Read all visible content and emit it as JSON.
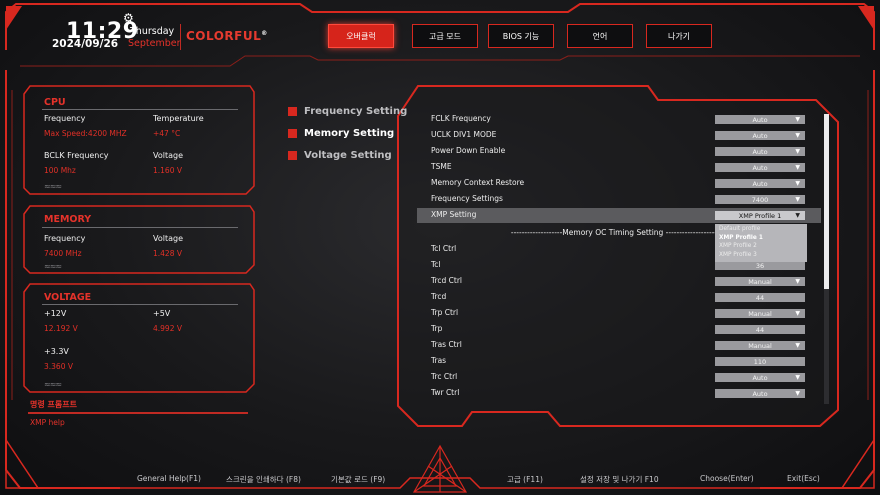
{
  "header": {
    "time": "11:29",
    "date": "2024/09/26",
    "weekday": "Thursday",
    "month": "September",
    "brand": "COLORFUL",
    "brand_mark": "®"
  },
  "tabs": [
    {
      "label": "오버클럭",
      "active": true
    },
    {
      "label": "고급 모드",
      "active": false
    },
    {
      "label": "BIOS 기능",
      "active": false
    },
    {
      "label": "언어",
      "active": false
    },
    {
      "label": "나가기",
      "active": false
    }
  ],
  "cpu": {
    "title": "CPU",
    "frequency_label": "Frequency",
    "frequency_value": "Max Speed:4200 MHZ",
    "temperature_label": "Temperature",
    "temperature_value": "+47 °C",
    "bclk_label": "BCLK Frequency",
    "bclk_value": "100 Mhz",
    "voltage_label": "Voltage",
    "voltage_value": "1.160 V"
  },
  "memory": {
    "title": "MEMORY",
    "frequency_label": "Frequency",
    "frequency_value": "7400 MHz",
    "voltage_label": "Voltage",
    "voltage_value": "1.428 V"
  },
  "voltage": {
    "title": "VOLTAGE",
    "v12_label": "+12V",
    "v12_value": "12.192 V",
    "v5_label": "+5V",
    "v5_value": "4.992 V",
    "v33_label": "+3.3V",
    "v33_value": "3.360 V"
  },
  "help": {
    "title": "명령 프롬프트",
    "text": "XMP help"
  },
  "submenu": [
    {
      "label": "Frequency Setting",
      "active": false
    },
    {
      "label": "Memory Setting",
      "active": true
    },
    {
      "label": "Voltage Setting",
      "active": false
    }
  ],
  "settings": [
    {
      "label": "FCLK Frequency",
      "value": "Auto",
      "dropdown": true
    },
    {
      "label": "UCLK DIV1 MODE",
      "value": "Auto",
      "dropdown": true
    },
    {
      "label": "Power Down Enable",
      "value": "Auto",
      "dropdown": true
    },
    {
      "label": "TSME",
      "value": "Auto",
      "dropdown": true
    },
    {
      "label": "Memory Context Restore",
      "value": "Auto",
      "dropdown": true
    },
    {
      "label": "Frequency Settings",
      "value": "7400",
      "dropdown": true
    },
    {
      "label": "XMP Setting",
      "value": "XMP Profile 1",
      "dropdown": true,
      "selected": true
    }
  ],
  "section_header": "-------------------Memory OC Timing Setting -------------------",
  "timings": [
    {
      "label": "Tcl Ctrl",
      "value": "",
      "dropdown": false,
      "hidden_by_popup": true
    },
    {
      "label": "Tcl",
      "value": "36",
      "dropdown": false
    },
    {
      "label": "Trcd Ctrl",
      "value": "Manual",
      "dropdown": true
    },
    {
      "label": "Trcd",
      "value": "44",
      "dropdown": false
    },
    {
      "label": "Trp Ctrl",
      "value": "Manual",
      "dropdown": true
    },
    {
      "label": "Trp",
      "value": "44",
      "dropdown": false
    },
    {
      "label": "Tras Ctrl",
      "value": "Manual",
      "dropdown": true
    },
    {
      "label": "Tras",
      "value": "110",
      "dropdown": false
    },
    {
      "label": "Trc Ctrl",
      "value": "Auto",
      "dropdown": true
    },
    {
      "label": "Twr Ctrl",
      "value": "Auto",
      "dropdown": true
    }
  ],
  "xmp_dropdown": {
    "options": [
      "Default profile",
      "XMP Profile 1",
      "XMP Profile 2",
      "XMP Profile 3"
    ],
    "current": "XMP Profile 1"
  },
  "footer": [
    {
      "label": "General Help(F1)"
    },
    {
      "label": "스크린을 인쇄하다 (F8)"
    },
    {
      "label": "기본값 로드 (F9)"
    },
    {
      "label": "고급 (F11)"
    },
    {
      "label": "설정 저장 및 나가기 F10"
    },
    {
      "label": "Choose(Enter)"
    },
    {
      "label": "Exit(Esc)"
    }
  ],
  "colors": {
    "accent": "#e4322a",
    "background": "#1b1b1d",
    "control": "#9a9a9e"
  }
}
